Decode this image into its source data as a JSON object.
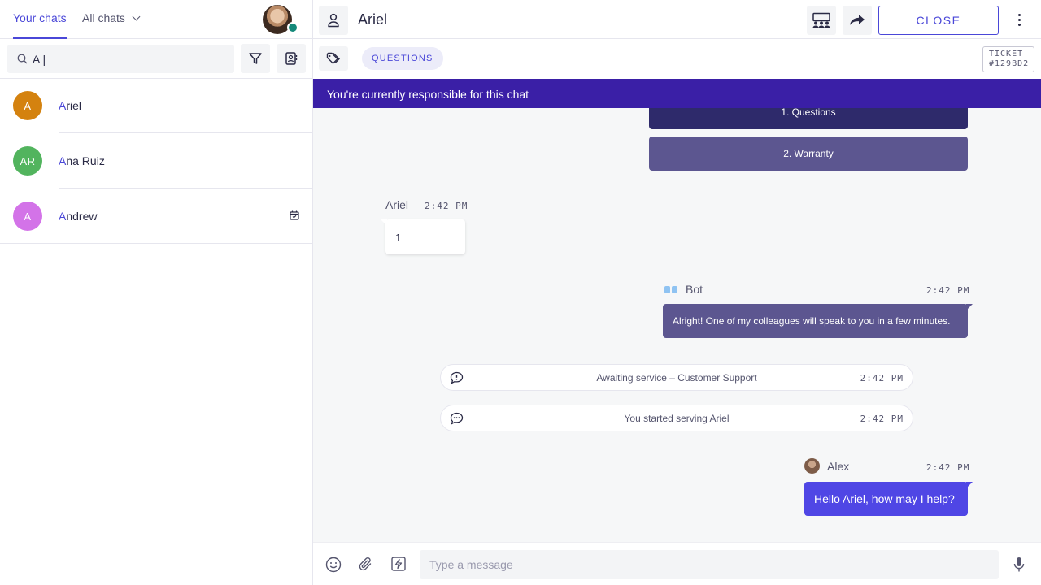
{
  "sidebar": {
    "tabs": {
      "your_chats": "Your chats",
      "all_chats": "All chats"
    },
    "search": {
      "value": "A |",
      "placeholder": ""
    },
    "contacts": [
      {
        "initials": "A",
        "highlight": "A",
        "rest": "riel",
        "color": "#d4820f"
      },
      {
        "initials": "AR",
        "highlight": "A",
        "rest": "na Ruiz",
        "color": "#52b45e"
      },
      {
        "initials": "A",
        "highlight": "A",
        "rest": "ndrew",
        "color": "#d373e8",
        "icon": "calendar-check-icon"
      }
    ]
  },
  "header": {
    "title": "Ariel",
    "close_label": "CLOSE",
    "icons": [
      "person-icon",
      "team-transfer-icon",
      "forward-icon",
      "more-vertical-icon"
    ]
  },
  "tagbar": {
    "tag": "QUESTIONS",
    "ticket_label": "TICKET",
    "ticket_id": "#129BD2"
  },
  "banner": {
    "text": "You're currently responsible for this chat"
  },
  "conversation": {
    "options": [
      "1. Questions",
      "2. Warranty"
    ],
    "customer": {
      "name": "Ariel",
      "time": "2:42 PM",
      "text": "1"
    },
    "bot": {
      "name": "Bot",
      "time": "2:42 PM",
      "text": "Alright! One of my colleagues will speak to you in a few minutes."
    },
    "system": [
      {
        "text": "Awaiting service – Customer Support",
        "time": "2:42 PM",
        "icon": "speech-alert-icon"
      },
      {
        "text": "You started serving Ariel",
        "time": "2:42 PM",
        "icon": "chat-dots-icon"
      }
    ],
    "agent": {
      "name": "Alex",
      "time": "2:42 PM",
      "text": "Hello Ariel, how may I help?"
    }
  },
  "composer": {
    "placeholder": "Type a message"
  },
  "colors": {
    "accent": "#4a47d8",
    "banner": "#3a1fa6",
    "bot_bubble": "#5c5690",
    "agent_bubble": "#4f46e5"
  }
}
